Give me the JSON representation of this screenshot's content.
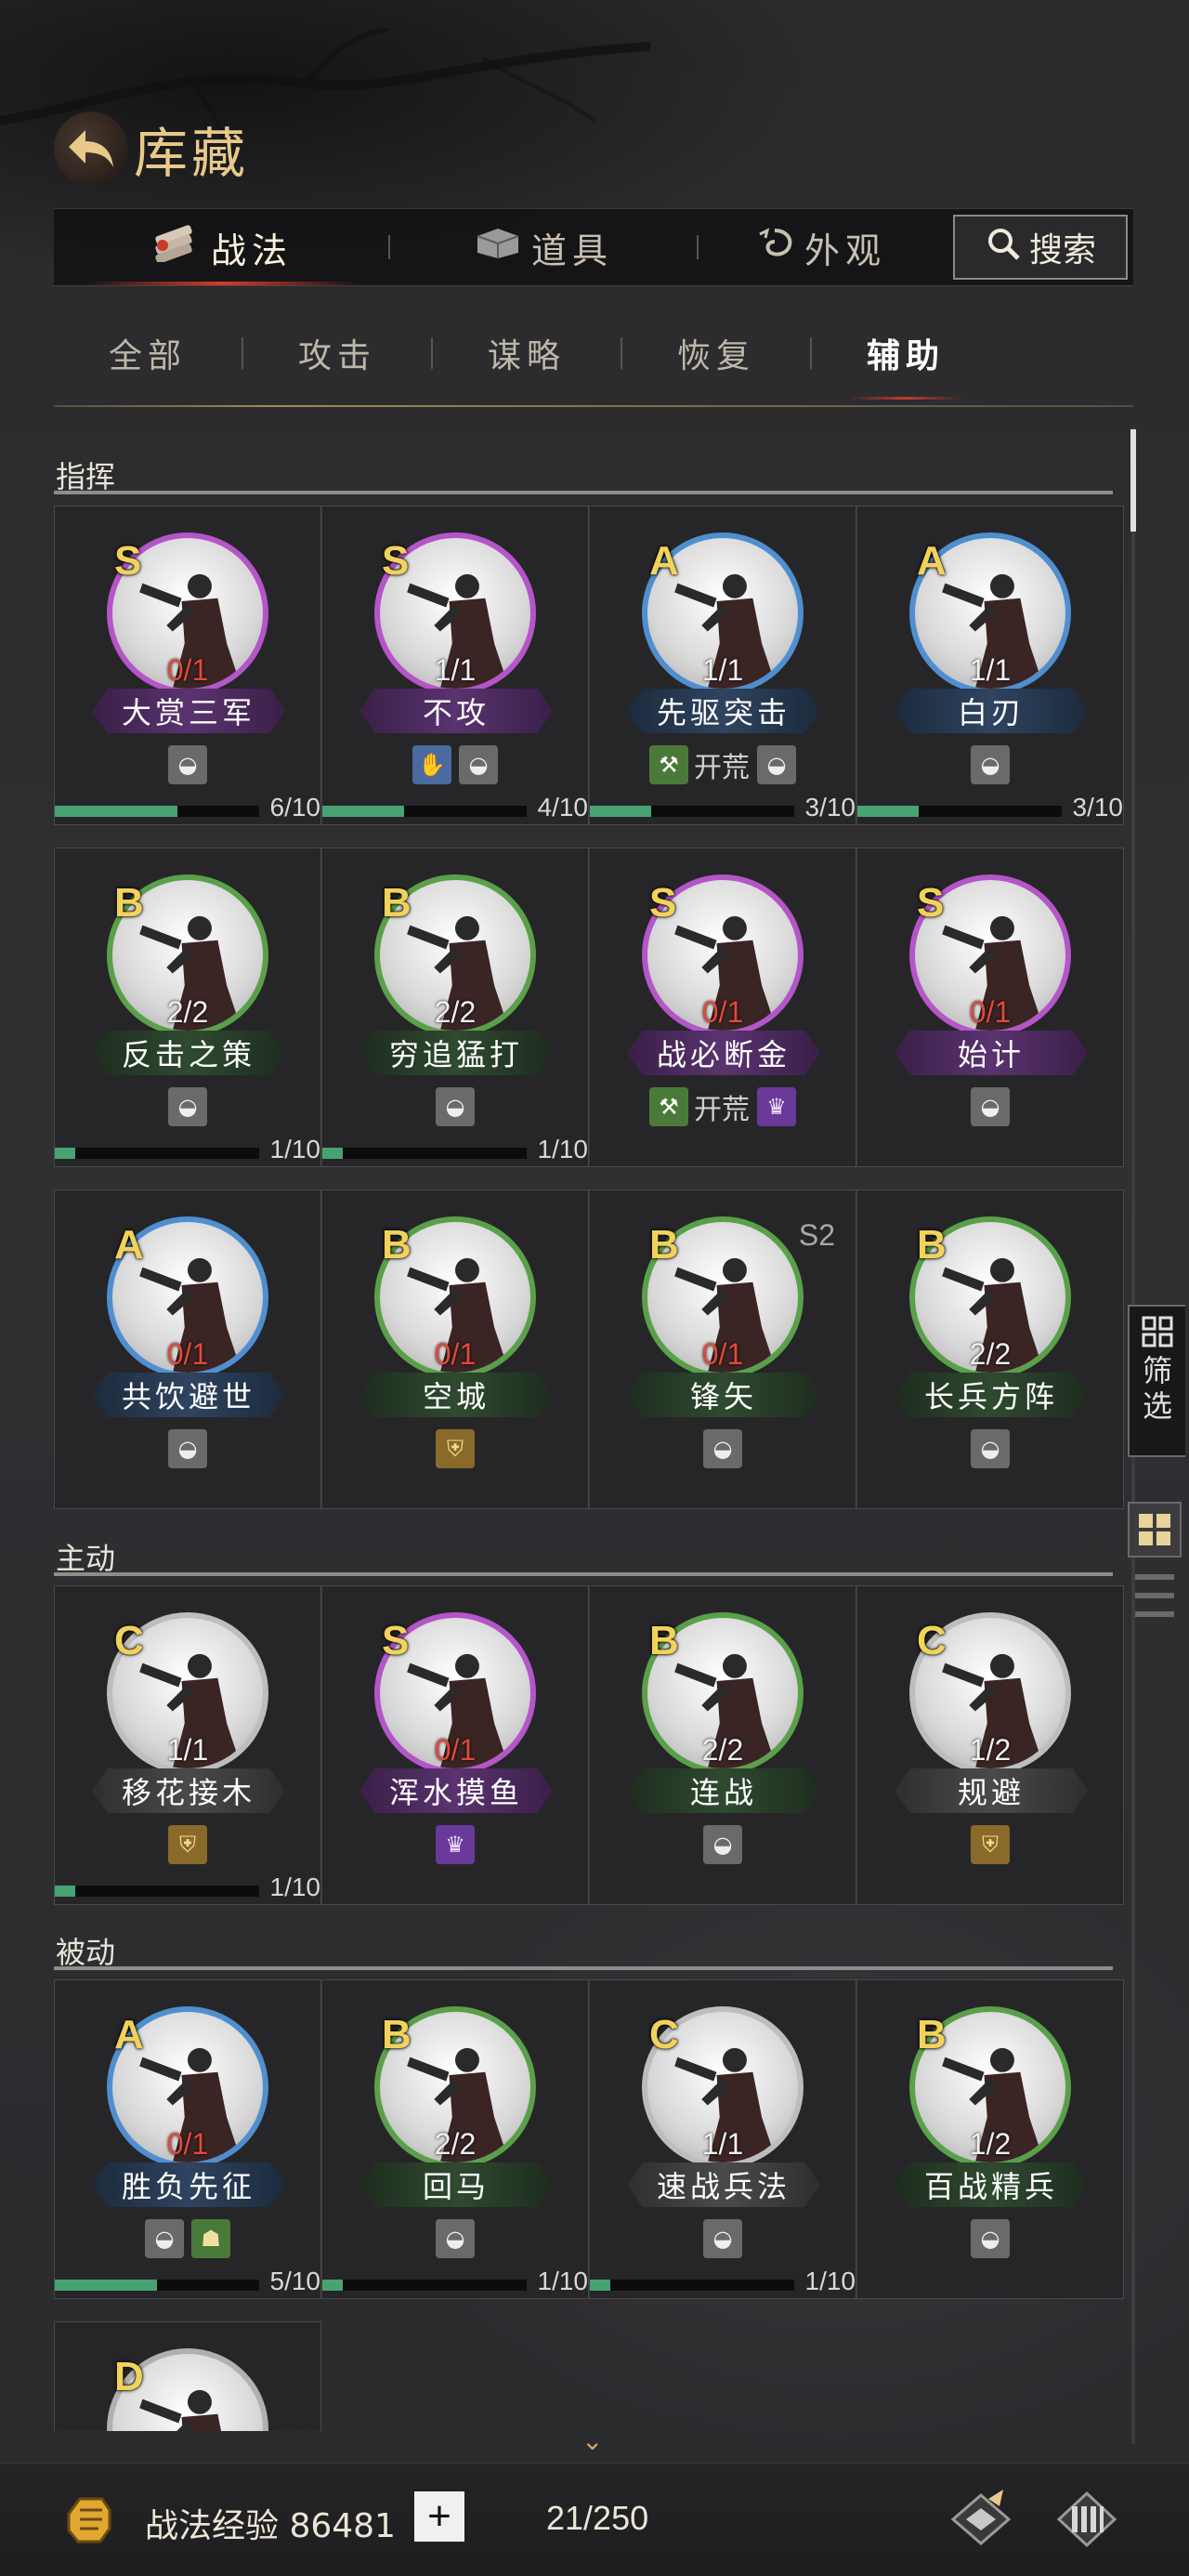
{
  "header": {
    "title": "库藏"
  },
  "tabs": [
    {
      "label": "战法",
      "active": true
    },
    {
      "label": "道具",
      "active": false
    },
    {
      "label": "外观",
      "active": false
    }
  ],
  "search": {
    "label": "搜索"
  },
  "subtabs": [
    {
      "label": "全部",
      "active": false
    },
    {
      "label": "攻击",
      "active": false
    },
    {
      "label": "谋略",
      "active": false
    },
    {
      "label": "恢复",
      "active": false
    },
    {
      "label": "辅助",
      "active": true
    }
  ],
  "sections": [
    {
      "label": "指挥"
    },
    {
      "label": "主动"
    },
    {
      "label": "被动"
    }
  ],
  "cards": [
    {
      "grade": "S",
      "name": "大赏三军",
      "count": "0/1",
      "tags": [
        "bag"
      ],
      "progress": {
        "label": "6/10",
        "value": 0.6
      }
    },
    {
      "grade": "S",
      "name": "不攻",
      "count": "1/1",
      "tags": [
        "glove",
        "bag"
      ],
      "progress": {
        "label": "4/10",
        "value": 0.4
      }
    },
    {
      "grade": "A",
      "name": "先驱突击",
      "count": "1/1",
      "tags": [
        "axe",
        "bag"
      ],
      "tag_text": "开荒",
      "progress": {
        "label": "3/10",
        "value": 0.3
      }
    },
    {
      "grade": "A",
      "name": "白刃",
      "count": "1/1",
      "tags": [
        "bag"
      ],
      "progress": {
        "label": "3/10",
        "value": 0.3
      }
    },
    {
      "grade": "B",
      "name": "反击之策",
      "count": "2/2",
      "tags": [
        "bag"
      ],
      "progress": {
        "label": "1/10",
        "value": 0.1
      }
    },
    {
      "grade": "B",
      "name": "穷追猛打",
      "count": "2/2",
      "tags": [
        "bag"
      ],
      "progress": {
        "label": "1/10",
        "value": 0.1
      }
    },
    {
      "grade": "S",
      "name": "战必断金",
      "count": "0/1",
      "tags": [
        "axe",
        "helm"
      ],
      "tag_text": "开荒"
    },
    {
      "grade": "S",
      "name": "始计",
      "count": "0/1",
      "tags": [
        "bag"
      ]
    },
    {
      "grade": "A",
      "name": "共饮避世",
      "count": "0/1",
      "tags": [
        "bag"
      ]
    },
    {
      "grade": "B",
      "name": "空城",
      "count": "0/1",
      "tags": [
        "shield"
      ]
    },
    {
      "grade": "B",
      "name": "锋矢",
      "count": "0/1",
      "tags": [
        "bag"
      ],
      "season": "S2"
    },
    {
      "grade": "B",
      "name": "长兵方阵",
      "count": "2/2",
      "tags": [
        "bag"
      ]
    },
    {
      "grade": "C",
      "name": "移花接木",
      "count": "1/1",
      "tags": [
        "shield"
      ],
      "progress": {
        "label": "1/10",
        "value": 0.1
      }
    },
    {
      "grade": "S",
      "name": "浑水摸鱼",
      "count": "0/1",
      "tags": [
        "helm"
      ]
    },
    {
      "grade": "B",
      "name": "连战",
      "count": "2/2",
      "tags": [
        "bag"
      ]
    },
    {
      "grade": "C",
      "name": "规避",
      "count": "1/2",
      "tags": [
        "shield"
      ]
    },
    {
      "grade": "A",
      "name": "胜负先征",
      "count": "0/1",
      "tags": [
        "bag",
        "pot"
      ],
      "progress": {
        "label": "5/10",
        "value": 0.5
      }
    },
    {
      "grade": "B",
      "name": "回马",
      "count": "2/2",
      "tags": [
        "bag"
      ],
      "progress": {
        "label": "1/10",
        "value": 0.1
      }
    },
    {
      "grade": "C",
      "name": "速战兵法",
      "count": "1/1",
      "tags": [
        "bag"
      ],
      "progress": {
        "label": "1/10",
        "value": 0.1
      }
    },
    {
      "grade": "B",
      "name": "百战精兵",
      "count": "1/2",
      "tags": [
        "bag"
      ]
    },
    {
      "grade": "D"
    }
  ],
  "side": {
    "filter_label_1": "筛",
    "filter_label_2": "选"
  },
  "bottom": {
    "exp_label": "战法经验 86481",
    "plus": "+",
    "capacity": "21/250"
  },
  "icons": {
    "back": "back-arrow-icon",
    "tab_skill": "scroll-bundle-icon",
    "tab_item": "chest-icon",
    "tab_look": "swirl-icon",
    "search": "search-icon",
    "filter": "grid-icon",
    "exp": "fist-icon",
    "bb1": "book-brush-icon",
    "bb2": "bamboo-scroll-icon"
  },
  "colors": {
    "grade_S": "#b455c8",
    "grade_A": "#4f8fd0",
    "grade_B": "#5aa04a",
    "grade_C": "#bdbdbd",
    "grade_text": "#f2d25a",
    "zero_count": "#e04a3a",
    "progress_fill": "#47a372",
    "title_gold": "#e8c98a"
  }
}
